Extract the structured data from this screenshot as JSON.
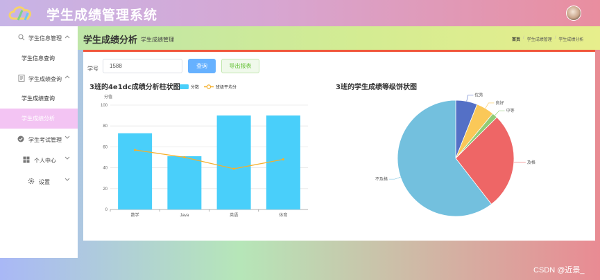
{
  "app": {
    "title": "学生成绩管理系统",
    "logo_icon": "cloud-logo-icon"
  },
  "sidebar": {
    "groups": [
      {
        "label": "学生信息管理",
        "icon": "search-icon",
        "chevron": "chevron-up-icon",
        "items": [
          {
            "label": "学生信息查询",
            "active": false
          }
        ]
      },
      {
        "label": "学生成绩查询",
        "icon": "document-icon",
        "chevron": "chevron-up-icon",
        "items": [
          {
            "label": "学生成绩查询",
            "active": false
          },
          {
            "label": "学生成绩分析",
            "active": true
          }
        ]
      },
      {
        "label": "学生考试管理",
        "icon": "check-circle-icon",
        "chevron": "chevron-down-icon",
        "items": []
      },
      {
        "label": "个人中心",
        "icon": "grid-icon",
        "chevron": "chevron-down-icon",
        "items": []
      },
      {
        "label": "设置",
        "icon": "gear-icon",
        "chevron": "chevron-down-icon",
        "items": []
      }
    ]
  },
  "page": {
    "title": "学生成绩分析",
    "subtitle": "学生成绩管理",
    "breadcrumb": [
      "首页",
      "学生成绩管理",
      "学生成绩分析"
    ]
  },
  "search": {
    "label": "学号",
    "value": "1588",
    "query_button": "查询",
    "export_button": "导出报表"
  },
  "chart_data": [
    {
      "type": "bar",
      "title": "3班的4e1dc成绩分析柱状图",
      "categories": [
        "数学",
        "Java",
        "英语",
        "体育"
      ],
      "ylabel": "分值",
      "ylim": [
        0,
        100
      ],
      "yticks": [
        0,
        20,
        40,
        60,
        80,
        100
      ],
      "grid": true,
      "legend_position": "top",
      "series": [
        {
          "name": "分数",
          "kind": "bar",
          "values": [
            73,
            51,
            90,
            90
          ],
          "color": "#49cffa"
        },
        {
          "name": "班级平均分",
          "kind": "line",
          "values": [
            57,
            50,
            39,
            48
          ],
          "color": "#f5b02c"
        }
      ]
    },
    {
      "type": "pie",
      "title": "3班的学生成绩等级饼状图",
      "slices": [
        {
          "label": "优秀",
          "value": 6,
          "color": "#5470c6"
        },
        {
          "label": "良好",
          "value": 5,
          "color": "#fac858"
        },
        {
          "label": "中等",
          "value": 1.5,
          "color": "#91cc75"
        },
        {
          "label": "及格",
          "value": 27,
          "color": "#ee6666"
        },
        {
          "label": "不及格",
          "value": 60.5,
          "color": "#73c0de"
        }
      ]
    }
  ],
  "watermark": "CSDN @近景_"
}
